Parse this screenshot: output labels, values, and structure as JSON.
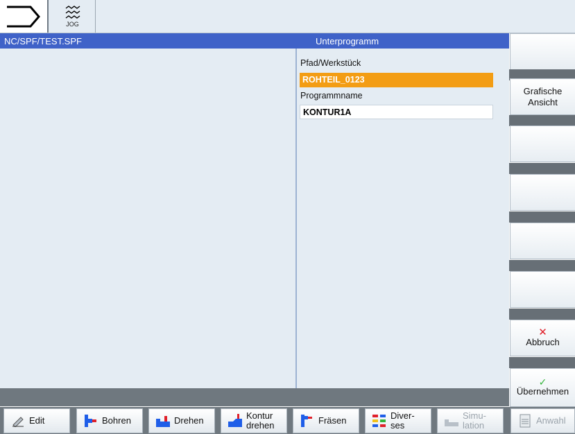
{
  "topbar": {
    "program_icon": "program-arrow-icon",
    "mode_icon": "jog-wave-icon",
    "mode_label": "JOG"
  },
  "main": {
    "path_title": "NC/SPF/TEST.SPF",
    "form_title": "Unterprogramm",
    "fields": {
      "path_label": "Pfad/Werkstück",
      "path_value": "ROHTEIL_0123",
      "name_label": "Programmname",
      "name_value": "KONTUR1A"
    }
  },
  "vertical_softkeys": {
    "key1": "",
    "key2_line1": "Grafische",
    "key2_line2": "Ansicht",
    "key3": "",
    "key4": "",
    "key5": "",
    "key6": "",
    "abbruch": "Abbruch",
    "uebernehmen": "Übernehmen"
  },
  "horizontal_softkeys": {
    "edit": "Edit",
    "bohren": "Bohren",
    "drehen": "Drehen",
    "kontur_line1": "Kontur",
    "kontur_line2": "drehen",
    "fraesen": "Fräsen",
    "divers_line1": "Diver-",
    "divers_line2": "ses",
    "simu_line1": "Simu-",
    "simu_line2": "lation",
    "anwahl": "Anwahl"
  },
  "colors": {
    "title_bar": "#3f62c8",
    "selected_field": "#f39d14",
    "background": "#e4ecf3",
    "cancel_mark": "#e0202a",
    "accept_mark": "#34b53b",
    "drill_icon_blue": "#1f5ee8",
    "drill_icon_red": "#e0202a"
  }
}
